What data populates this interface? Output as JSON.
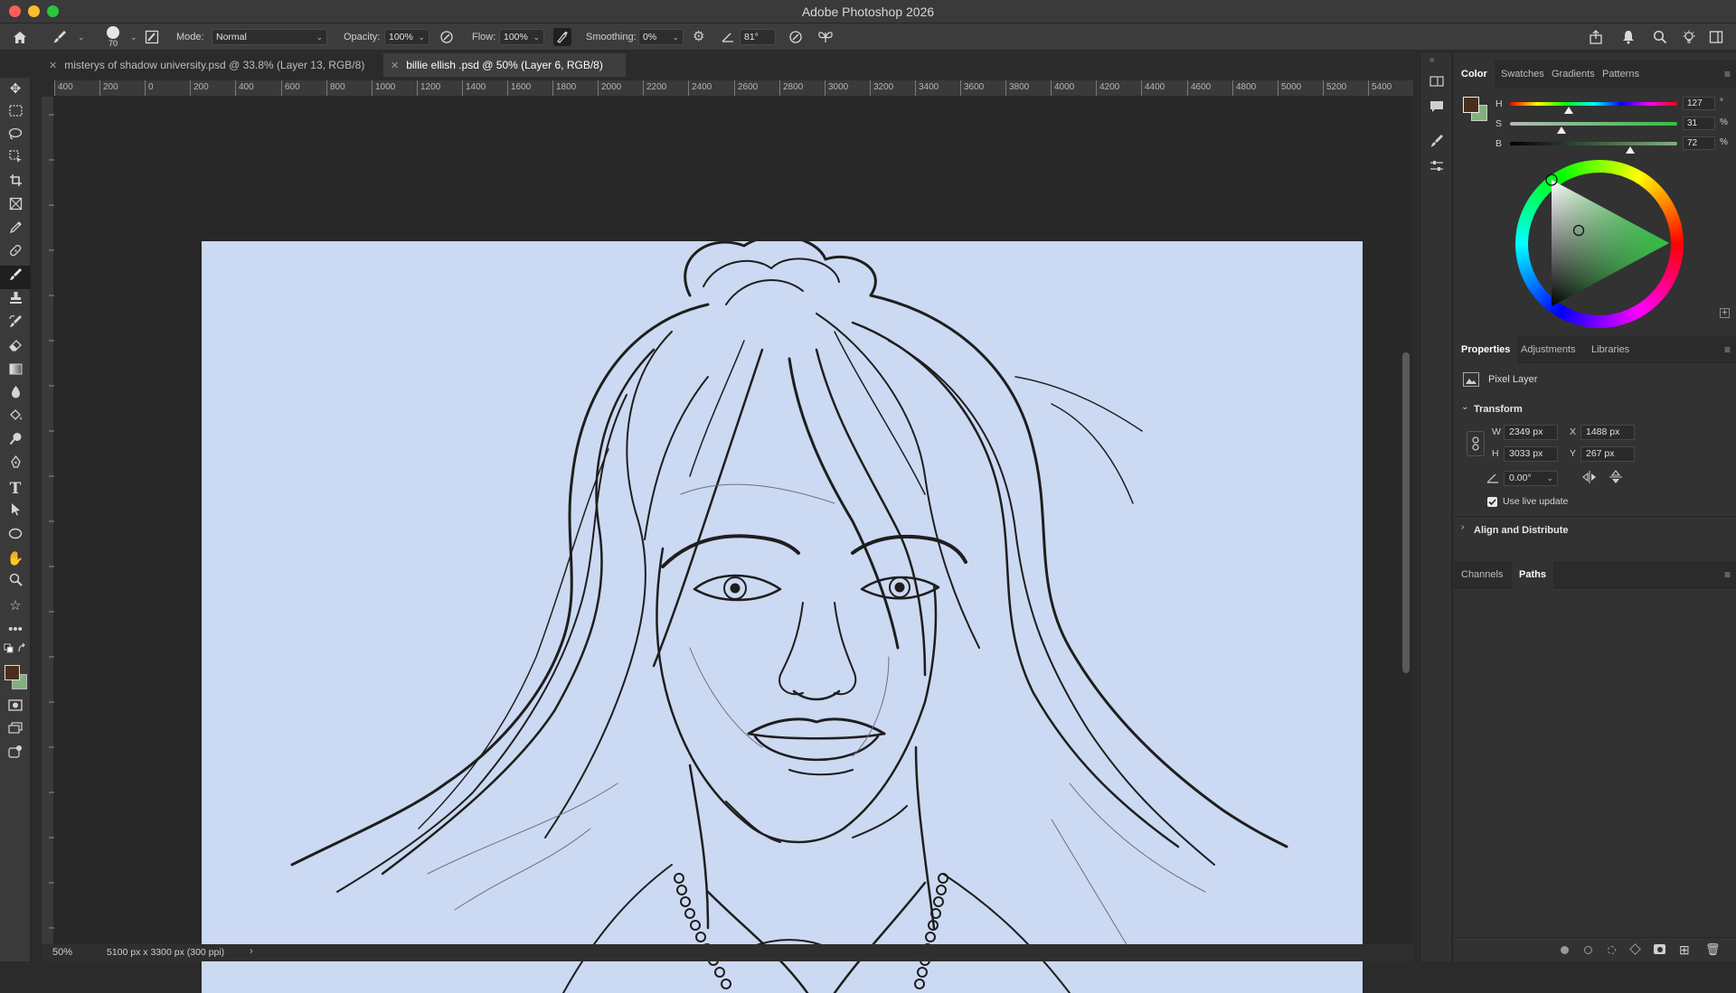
{
  "window": {
    "title": "Adobe Photoshop 2026"
  },
  "options_bar": {
    "brush_size": "70",
    "mode_label": "Mode:",
    "mode_value": "Normal",
    "opacity_label": "Opacity:",
    "opacity_value": "100%",
    "flow_label": "Flow:",
    "flow_value": "100%",
    "smoothing_label": "Smoothing:",
    "smoothing_value": "0%",
    "angle_value": "81°"
  },
  "tabs": [
    {
      "label": "misterys of shadow university.psd @ 33.8% (Layer 13, RGB/8)",
      "active": false
    },
    {
      "label": "billie ellish .psd @ 50% (Layer 6, RGB/8)",
      "active": true
    }
  ],
  "ruler": {
    "ticks": [
      "400",
      "200",
      "0",
      "200",
      "400",
      "600",
      "800",
      "1000",
      "1200",
      "1400",
      "1600",
      "1800",
      "2000",
      "2200",
      "2400",
      "2600",
      "2800",
      "3000",
      "3200",
      "3400",
      "3600",
      "3800",
      "4000",
      "4200",
      "4400",
      "4600",
      "4800",
      "5000",
      "5200",
      "5400"
    ]
  },
  "status": {
    "zoom": "50%",
    "doc_info": "5100 px x 3300 px (300 ppi)"
  },
  "color_panel": {
    "tabs": [
      "Color",
      "Swatches",
      "Gradients",
      "Patterns"
    ],
    "active_tab": "Color",
    "h_label": "H",
    "h_value": "127",
    "h_unit": "°",
    "h_level": 0.35,
    "s_label": "S",
    "s_value": "31",
    "s_unit": "%",
    "s_level": 0.31,
    "b_label": "B",
    "b_value": "72",
    "b_unit": "%",
    "b_level": 0.72,
    "foreground_color": "#4a2e1c",
    "background_color": "#7fb27f",
    "wheel_hue_color": "#2fbf3f"
  },
  "properties_panel": {
    "tabs": [
      "Properties",
      "Adjustments",
      "Libraries"
    ],
    "active_tab": "Properties",
    "layer_type": "Pixel Layer",
    "transform_title": "Transform",
    "w_label": "W",
    "w_value": "2349 px",
    "h_label": "H",
    "h_value": "3033 px",
    "x_label": "X",
    "x_value": "1488 px",
    "y_label": "Y",
    "y_value": "267 px",
    "angle_value": "0.00°",
    "live_update_label": "Use live update",
    "align_title": "Align and Distribute"
  },
  "bottom_panel": {
    "tabs": [
      "Channels",
      "Paths"
    ],
    "active_tab": "Paths"
  },
  "colors": {
    "canvas_bg": "#ccd9f2",
    "sketch_stroke": "#1e1e1e"
  }
}
